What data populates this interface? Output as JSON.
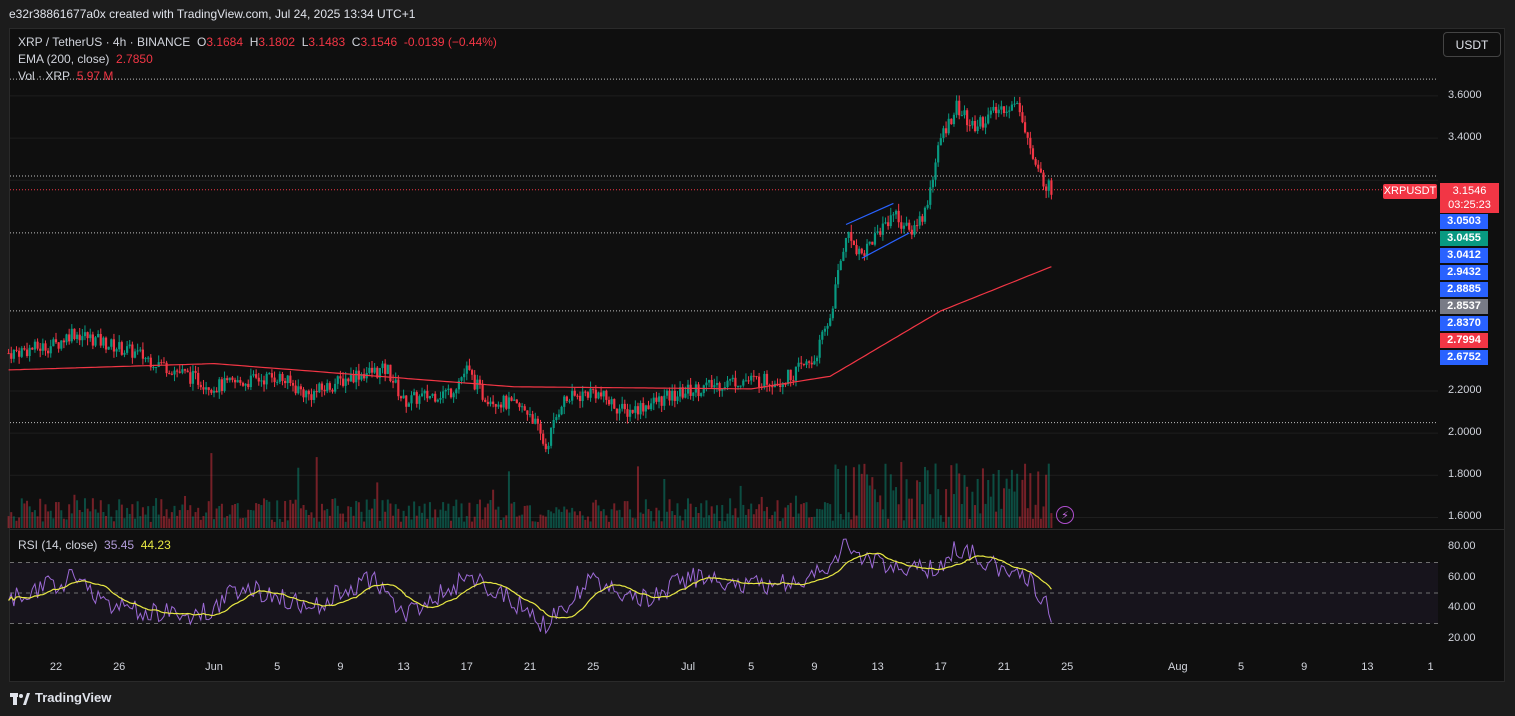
{
  "caption": "e32r38861677a0x created with TradingView.com, Jul 24, 2025 13:34 UTC+1",
  "legend": {
    "symbol": "XRP / TetherUS · 4h · BINANCE",
    "o_label": "O",
    "o_value": "3.1684",
    "h_label": "H",
    "h_value": "3.1802",
    "l_label": "L",
    "l_value": "3.1483",
    "c_label": "C",
    "c_value": "3.1546",
    "change": "-0.0139 (−0.44%)",
    "ema_label": "EMA (200, close)",
    "ema_value": "2.7850",
    "vol_label": "Vol · XRP",
    "vol_value": "5.97 M",
    "rsi_label": "RSI (14, close)",
    "rsi_value": "35.45",
    "rsi_ma_value": "44.23"
  },
  "currency_button": "USDT",
  "symbol_tag": "XRPUSDT",
  "last_price": {
    "price": "3.1546",
    "countdown": "03:25:23"
  },
  "price_tags": [
    {
      "label": "3.0503",
      "color": "#2962ff"
    },
    {
      "label": "3.0455",
      "color": "#089981"
    },
    {
      "label": "3.0412",
      "color": "#2962ff"
    },
    {
      "label": "2.9432",
      "color": "#2962ff"
    },
    {
      "label": "2.8885",
      "color": "#2962ff"
    },
    {
      "label": "2.8537",
      "color": "#787b86"
    },
    {
      "label": "2.8370",
      "color": "#2962ff"
    },
    {
      "label": "2.7994",
      "color": "#f23645"
    },
    {
      "label": "2.6752",
      "color": "#2962ff"
    }
  ],
  "y_axis": [
    "3.6000",
    "3.4000",
    "2.2000",
    "2.0000",
    "1.8000",
    "1.6000"
  ],
  "rsi_axis": [
    "80.00",
    "60.00",
    "40.00",
    "20.00"
  ],
  "x_axis": [
    "22",
    "26",
    "Jun",
    "5",
    "9",
    "13",
    "17",
    "21",
    "25",
    "Jul",
    "5",
    "9",
    "13",
    "17",
    "21",
    "25",
    "Aug",
    "5",
    "9",
    "13",
    "1"
  ],
  "footer": "TradingView",
  "colors": {
    "up": "#089981",
    "down": "#f23645",
    "ema": "#f23645",
    "rsi": "#9c6ad6",
    "rsi_ma": "#e8e843",
    "trendline": "#2962ff"
  },
  "chart_data": {
    "type": "candlestick",
    "interval": "4h",
    "price_levels_dotted": [
      3.68,
      3.22,
      2.95,
      2.58,
      2.05
    ],
    "price_anchors": [
      {
        "date": "May 19",
        "price": 2.38
      },
      {
        "date": "May 22",
        "price": 2.42
      },
      {
        "date": "May 23",
        "price": 2.48
      },
      {
        "date": "May 27",
        "price": 2.38
      },
      {
        "date": "Jun 1",
        "price": 2.22
      },
      {
        "date": "Jun 5",
        "price": 2.27
      },
      {
        "date": "Jun 7",
        "price": 2.18
      },
      {
        "date": "Jun 10",
        "price": 2.28
      },
      {
        "date": "Jun 12",
        "price": 2.3
      },
      {
        "date": "Jun 13",
        "price": 2.15
      },
      {
        "date": "Jun 16",
        "price": 2.2
      },
      {
        "date": "Jun 17",
        "price": 2.3
      },
      {
        "date": "Jun 18",
        "price": 2.18
      },
      {
        "date": "Jun 21",
        "price": 2.1
      },
      {
        "date": "Jun 22",
        "price": 1.93
      },
      {
        "date": "Jun 23",
        "price": 2.15
      },
      {
        "date": "Jun 25",
        "price": 2.2
      },
      {
        "date": "Jun 27",
        "price": 2.1
      },
      {
        "date": "Jul 1",
        "price": 2.2
      },
      {
        "date": "Jul 4",
        "price": 2.25
      },
      {
        "date": "Jul 7",
        "price": 2.25
      },
      {
        "date": "Jul 9",
        "price": 2.35
      },
      {
        "date": "Jul 10",
        "price": 2.55
      },
      {
        "date": "Jul 11",
        "price": 2.95
      },
      {
        "date": "Jul 12",
        "price": 2.85
      },
      {
        "date": "Jul 14",
        "price": 3.05
      },
      {
        "date": "Jul 15",
        "price": 2.95
      },
      {
        "date": "Jul 16",
        "price": 3.05
      },
      {
        "date": "Jul 17",
        "price": 3.4
      },
      {
        "date": "Jul 18",
        "price": 3.55
      },
      {
        "date": "Jul 19",
        "price": 3.45
      },
      {
        "date": "Jul 21",
        "price": 3.55
      },
      {
        "date": "Jul 22",
        "price": 3.55
      },
      {
        "date": "Jul 23",
        "price": 3.25
      },
      {
        "date": "Jul 24",
        "price": 3.15
      }
    ],
    "ema_anchors": [
      {
        "date": "May 19",
        "price": 2.3
      },
      {
        "date": "Jun 1",
        "price": 2.33
      },
      {
        "date": "Jun 20",
        "price": 2.22
      },
      {
        "date": "Jul 5",
        "price": 2.21
      },
      {
        "date": "Jul 10",
        "price": 2.27
      },
      {
        "date": "Jul 17",
        "price": 2.58
      },
      {
        "date": "Jul 24",
        "price": 2.79
      }
    ],
    "rsi_anchors": [
      {
        "date": "May 19",
        "rsi": 45
      },
      {
        "date": "May 23",
        "rsi": 60
      },
      {
        "date": "May 26",
        "rsi": 40
      },
      {
        "date": "May 31",
        "rsi": 35
      },
      {
        "date": "Jun 3",
        "rsi": 55
      },
      {
        "date": "Jun 7",
        "rsi": 40
      },
      {
        "date": "Jun 11",
        "rsi": 60
      },
      {
        "date": "Jun 13",
        "rsi": 35
      },
      {
        "date": "Jun 17",
        "rsi": 60
      },
      {
        "date": "Jun 20",
        "rsi": 45
      },
      {
        "date": "Jun 22",
        "rsi": 28
      },
      {
        "date": "Jun 25",
        "rsi": 60
      },
      {
        "date": "Jun 28",
        "rsi": 45
      },
      {
        "date": "Jul 1",
        "rsi": 60
      },
      {
        "date": "Jul 5",
        "rsi": 55
      },
      {
        "date": "Jul 9",
        "rsi": 60
      },
      {
        "date": "Jul 11",
        "rsi": 80
      },
      {
        "date": "Jul 14",
        "rsi": 65
      },
      {
        "date": "Jul 17",
        "rsi": 65
      },
      {
        "date": "Jul 18",
        "rsi": 80
      },
      {
        "date": "Jul 21",
        "rsi": 65
      },
      {
        "date": "Jul 23",
        "rsi": 55
      },
      {
        "date": "Jul 24",
        "rsi": 35
      }
    ],
    "rsi_levels": [
      70,
      50,
      30
    ],
    "ylim": [
      1.55,
      3.78
    ]
  }
}
